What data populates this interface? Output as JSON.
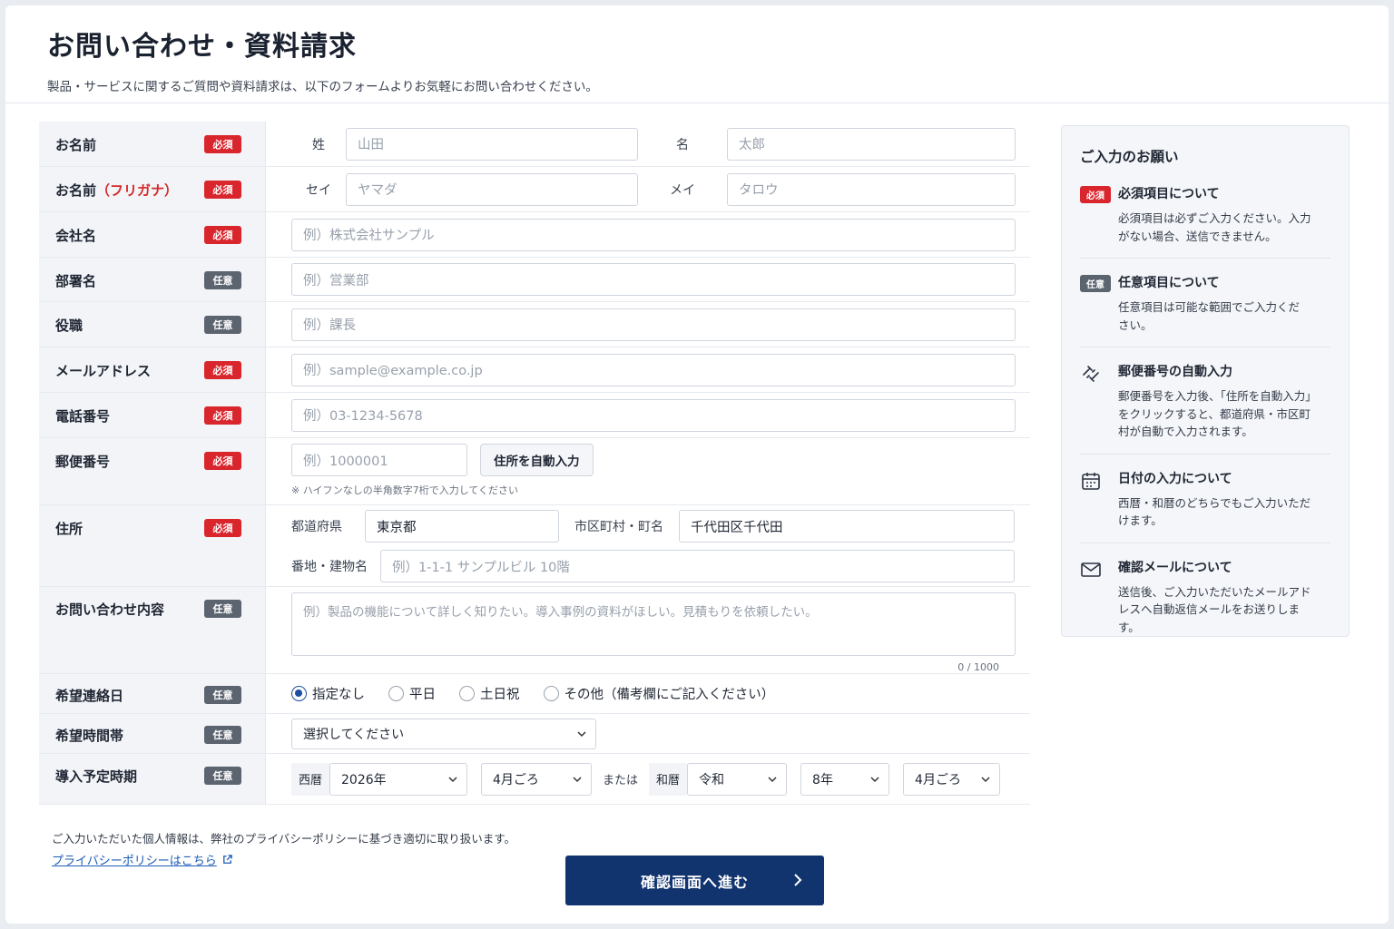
{
  "header": {
    "title": "お問い合わせ・資料請求",
    "description": "製品・サービスに関するご質問や資料請求は、以下のフォームよりお気軽にお問い合わせください。"
  },
  "badges": {
    "required": "必須",
    "optional": "任意"
  },
  "fields": {
    "name": {
      "label": "お名前",
      "last_label": "姓",
      "last_placeholder": "山田",
      "first_label": "名",
      "first_placeholder": "太郎"
    },
    "kana": {
      "label": "お名前",
      "label_suffix": "（フリガナ）",
      "last_label": "セイ",
      "last_placeholder": "ヤマダ",
      "first_label": "メイ",
      "first_placeholder": "タロウ"
    },
    "company": {
      "label": "会社名",
      "placeholder": "例）株式会社サンプル"
    },
    "department": {
      "label": "部署名",
      "placeholder": "例）営業部"
    },
    "position": {
      "label": "役職",
      "placeholder": "例）課長"
    },
    "email": {
      "label": "メールアドレス",
      "placeholder": "例）sample@example.co.jp"
    },
    "phone": {
      "label": "電話番号",
      "placeholder": "例）03-1234-5678"
    },
    "postal": {
      "label": "郵便番号",
      "placeholder": "例）1000001",
      "autofill_button": "住所を自動入力",
      "hint": "※ ハイフンなしの半角数字7桁で入力してください"
    },
    "address": {
      "label": "住所",
      "pref_label": "都道府県",
      "pref_value": "東京都",
      "city_label": "市区町村・町名",
      "city_value": "千代田区千代田",
      "street_label": "番地・建物名",
      "street_placeholder": "例）1-1-1 サンプルビル 10階"
    },
    "inquiry": {
      "label": "お問い合わせ内容",
      "placeholder": "例）製品の機能について詳しく知りたい。導入事例の資料がほしい。見積もりを依頼したい。",
      "counter": "0 / 1000"
    },
    "contact_day": {
      "label": "希望連絡日",
      "options": [
        "指定なし",
        "平日",
        "土日祝",
        "その他（備考欄にご記入ください）"
      ],
      "selected_index": 0
    },
    "contact_time": {
      "label": "希望時間帯",
      "selected": "選択してください"
    },
    "schedule": {
      "label": "導入予定時期",
      "western_label": "西暦",
      "western_year": "2026年",
      "western_month": "4月ごろ",
      "or_text": "または",
      "japanese_label": "和暦",
      "era": "令和",
      "era_year": "8年",
      "era_month": "4月ごろ"
    }
  },
  "sidebar": {
    "title": "ご入力のお願い",
    "items": [
      {
        "icon": "required-badge",
        "title": "必須項目について",
        "body": "必須項目は必ずご入力ください。入力がない場合、送信できません。"
      },
      {
        "icon": "optional-badge",
        "title": "任意項目について",
        "body": "任意項目は可能な範囲でご入力ください。"
      },
      {
        "icon": "auto-fill-icon",
        "title": "郵便番号の自動入力",
        "body": "郵便番号を入力後、「住所を自動入力」をクリックすると、都道府県・市区町村が自動で入力されます。"
      },
      {
        "icon": "calendar-icon",
        "title": "日付の入力について",
        "body": "西暦・和暦のどちらでもご入力いただけます。"
      },
      {
        "icon": "mail-icon",
        "title": "確認メールについて",
        "body": "送信後、ご入力いただいたメールアドレスへ自動返信メールをお送りします。"
      }
    ]
  },
  "footer": {
    "note": "ご入力いただいた個人情報は、弊社のプライバシーポリシーに基づき適切に取り扱います。",
    "privacy_link": "プライバシーポリシーはこちら",
    "submit": "確認画面へ進む"
  },
  "colors": {
    "required": "#d9262d",
    "optional": "#5c6470",
    "primary": "#12346e",
    "link": "#1b5bb5"
  }
}
